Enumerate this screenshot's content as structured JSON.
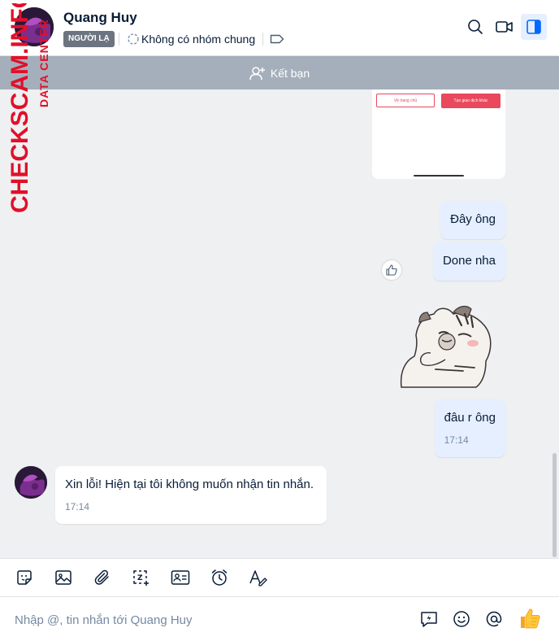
{
  "header": {
    "name": "Quang Huy",
    "badge": "NGƯỜI LẠ",
    "group_status": "Không có nhóm chung",
    "icons": [
      "tag-icon",
      "search-icon",
      "video-call-icon",
      "sidebar-toggle-icon"
    ]
  },
  "friend_bar": {
    "label": "Kết bạn",
    "icon": "add-friend-icon"
  },
  "card": {
    "button_left": "Về trang chủ",
    "button_right": "Tạo giao dịch khác"
  },
  "messages": [
    {
      "from": "me",
      "text": "Đây ông"
    },
    {
      "from": "me",
      "text": "Done nha"
    },
    {
      "from": "me",
      "type": "sticker",
      "sticker": "cat-sticker"
    },
    {
      "from": "me",
      "text": "đâu r ông",
      "time": "17:14"
    },
    {
      "from": "them",
      "text": "Xin lỗi! Hiện tại tôi không muốn nhận tin nhắn.",
      "time": "17:14"
    }
  ],
  "toolbar": {
    "icons": [
      "sticker-icon",
      "image-icon",
      "attach-icon",
      "screenshot-icon",
      "contact-card-icon",
      "reminder-icon",
      "text-format-icon"
    ]
  },
  "composer": {
    "placeholder": "Nhập @, tin nhắn tới Quang Huy",
    "icons": [
      "quick-message-icon",
      "emoji-icon",
      "mention-icon",
      "thumbs-up-icon"
    ]
  },
  "watermark": {
    "main": "CHECKSCAM.INFO",
    "sub": "DATA CENTER"
  },
  "colors": {
    "accent": "#0068ff",
    "bubble_me": "#e5efff",
    "friend_bar": "#a5afbb",
    "watermark": "#e0102a"
  }
}
